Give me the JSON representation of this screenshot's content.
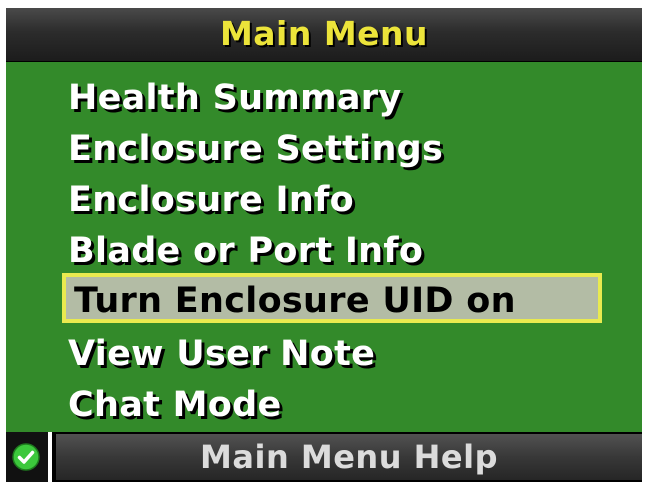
{
  "header": {
    "title": "Main Menu"
  },
  "menu": {
    "items": [
      {
        "label": "Health Summary",
        "selected": false
      },
      {
        "label": "Enclosure Settings",
        "selected": false
      },
      {
        "label": "Enclosure Info",
        "selected": false
      },
      {
        "label": "Blade or Port Info",
        "selected": false
      },
      {
        "label": "Turn Enclosure UID on",
        "selected": true
      },
      {
        "label": "View User Note",
        "selected": false
      },
      {
        "label": "Chat Mode",
        "selected": false
      }
    ]
  },
  "footer": {
    "status_icon": "check-icon",
    "help_label": "Main Menu Help"
  },
  "colors": {
    "title_text": "#ece43a",
    "content_background": "#338a2a",
    "selection_border": "#e9ea4f",
    "selection_fill": "#b3bca5",
    "status_ok": "#3cc83c"
  }
}
